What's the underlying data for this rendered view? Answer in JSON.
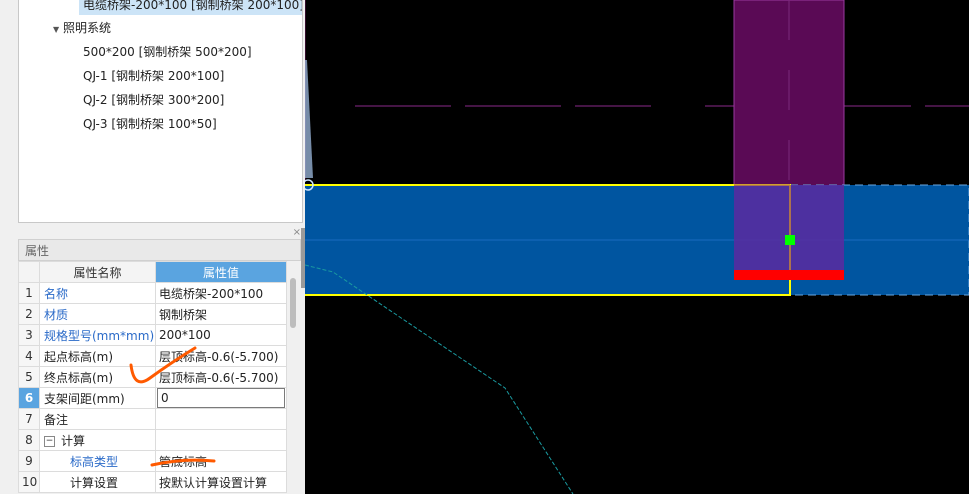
{
  "tree": {
    "selected_item": "电缆桥架-200*100 [钢制桥架 200*100]",
    "group_label": "照明系统",
    "items": [
      "500*200 [钢制桥架 500*200]",
      "QJ-1 [钢制桥架 200*100]",
      "QJ-2 [钢制桥架 300*200]",
      "QJ-3 [钢制桥架 100*50]"
    ]
  },
  "properties": {
    "panel_title": "属性",
    "close_glyph": "×",
    "headers": {
      "name": "属性名称",
      "value": "属性值"
    },
    "rows": [
      {
        "num": "1",
        "name": "名称",
        "value": "电缆桥架-200*100"
      },
      {
        "num": "2",
        "name": "材质",
        "value": "钢制桥架"
      },
      {
        "num": "3",
        "name": "规格型号(mm*mm)",
        "value": "200*100"
      },
      {
        "num": "4",
        "name": "起点标高(m)",
        "value": "层顶标高-0.6(-5.700)"
      },
      {
        "num": "5",
        "name": "终点标高(m)",
        "value": "层顶标高-0.6(-5.700)"
      },
      {
        "num": "6",
        "name": "支架间距(mm)",
        "value": "0"
      },
      {
        "num": "7",
        "name": "备注",
        "value": ""
      },
      {
        "num": "8",
        "name": "计算",
        "value": "",
        "expander": "−"
      },
      {
        "num": "9",
        "name": "标高类型",
        "value": "管底标高"
      },
      {
        "num": "10",
        "name": "计算设置",
        "value": "按默认计算设置计算"
      }
    ]
  },
  "colors": {
    "canvas_bg": "#000000",
    "tray_fill": "#0055a0",
    "tray_outline": "#ffff00",
    "vertical_fill": "#5a0a55",
    "selection_handle": "#00ff00",
    "marker_red": "#ff0000",
    "annotation_orange": "#ff5a00"
  }
}
